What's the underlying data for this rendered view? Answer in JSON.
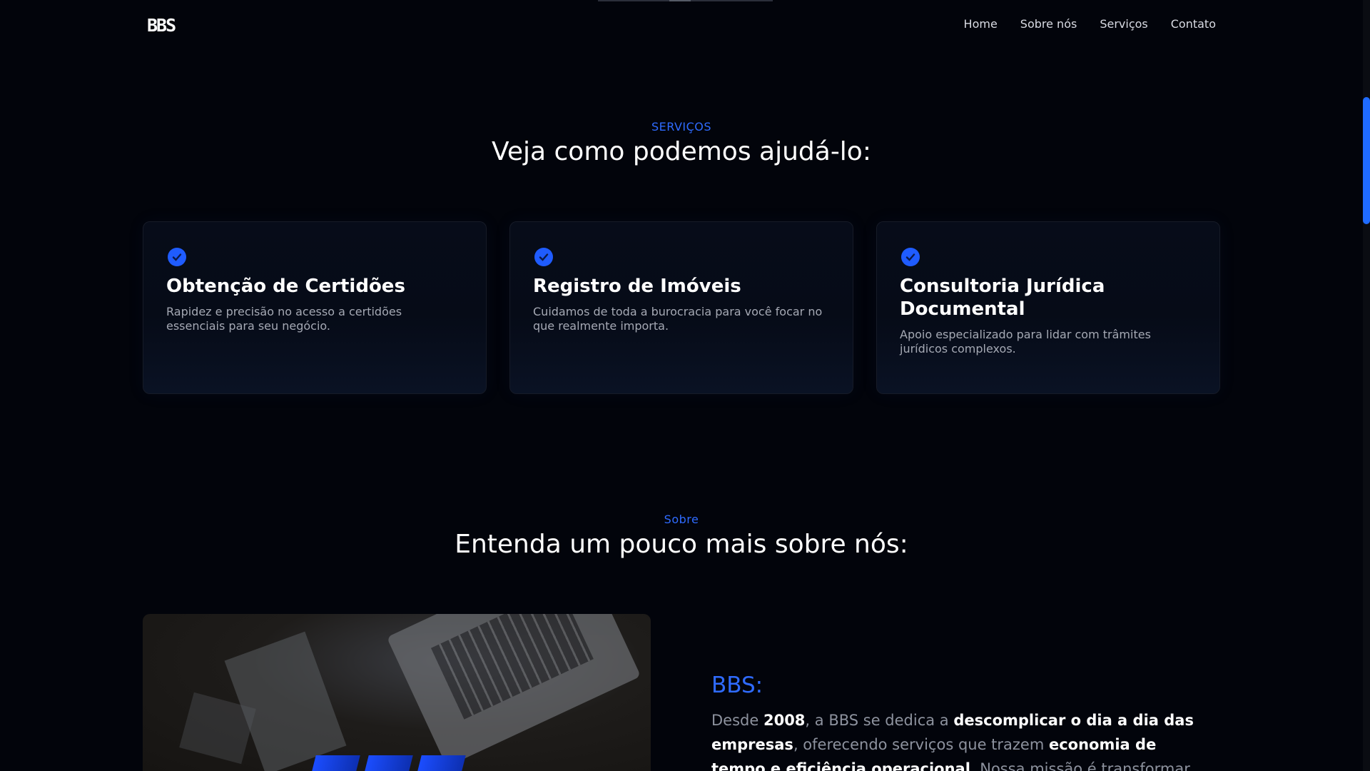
{
  "header": {
    "logo_text": "BBS",
    "nav": [
      {
        "label": "Home"
      },
      {
        "label": "Sobre nós"
      },
      {
        "label": "Serviços"
      },
      {
        "label": "Contato"
      }
    ]
  },
  "services": {
    "kicker": "SERVIÇOS",
    "title": "Veja como podemos ajudá-lo:",
    "cards": [
      {
        "title": "Obtenção de Certidões",
        "text": "Rapidez e precisão no acesso a certidões essenciais para seu negócio.",
        "icon": "check-icon"
      },
      {
        "title": "Registro de Imóveis",
        "text": "Cuidamos de toda a burocracia para você focar no que realmente importa.",
        "icon": "check-icon"
      },
      {
        "title": "Consultoria Jurídica Documental",
        "text": "Apoio especializado para lidar com trâmites jurídicos complexos.",
        "icon": "check-icon"
      }
    ]
  },
  "about": {
    "kicker": "Sobre",
    "title": "Entenda um pouco mais sobre nós:",
    "heading": "BBS:",
    "p_1": "Desde ",
    "p_2": "2008",
    "p_3": ", a BBS se dedica a ",
    "p_4": "descomplicar o dia a dia das empresas",
    "p_5": ", oferecendo serviços que trazem ",
    "p_6": "economia de tempo e eficiência operacional",
    "p_7": ". Nossa missão é transformar processos"
  },
  "colors": {
    "background": "#02040b",
    "accent": "#2f6bff",
    "card_bg": "#070c19"
  }
}
